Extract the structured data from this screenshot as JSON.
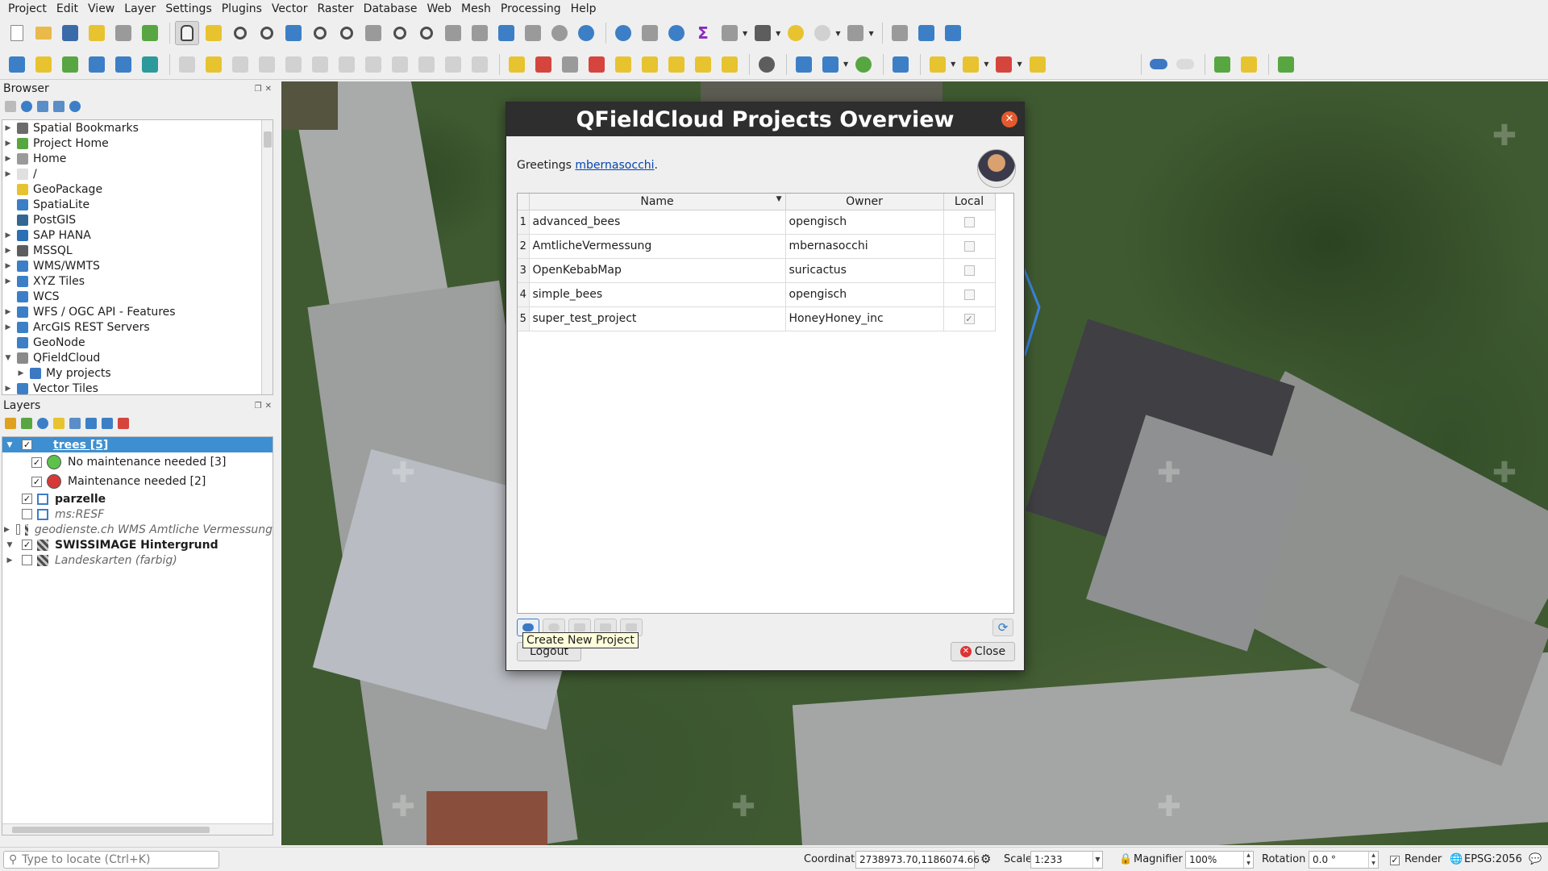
{
  "menu": [
    "Project",
    "Edit",
    "View",
    "Layer",
    "Settings",
    "Plugins",
    "Vector",
    "Raster",
    "Database",
    "Web",
    "Mesh",
    "Processing",
    "Help"
  ],
  "browser": {
    "title": "Browser",
    "items": [
      {
        "label": "Spatial Bookmarks",
        "icon": "bookmark-icon",
        "color": "#6b6b6b",
        "expandable": true
      },
      {
        "label": "Project Home",
        "icon": "project-home-icon",
        "color": "#58a642",
        "expandable": true
      },
      {
        "label": "Home",
        "icon": "home-icon",
        "color": "#9a9a9a",
        "expandable": true
      },
      {
        "label": "/",
        "icon": "folder-icon",
        "color": "#e0e0e0",
        "expandable": true
      },
      {
        "label": "GeoPackage",
        "icon": "geopackage-icon",
        "color": "#e8c330",
        "expandable": false
      },
      {
        "label": "SpatiaLite",
        "icon": "spatialite-icon",
        "color": "#3c7fc6",
        "expandable": false
      },
      {
        "label": "PostGIS",
        "icon": "postgis-icon",
        "color": "#336791",
        "expandable": false
      },
      {
        "label": "SAP HANA",
        "icon": "sap-hana-icon",
        "color": "#2c6fb4",
        "expandable": true
      },
      {
        "label": "MSSQL",
        "icon": "mssql-icon",
        "color": "#5d5d5d",
        "expandable": true
      },
      {
        "label": "WMS/WMTS",
        "icon": "wms-icon",
        "color": "#3c7fc6",
        "expandable": true
      },
      {
        "label": "XYZ Tiles",
        "icon": "xyz-tiles-icon",
        "color": "#3c7fc6",
        "expandable": true
      },
      {
        "label": "WCS",
        "icon": "wcs-icon",
        "color": "#3c7fc6",
        "expandable": false
      },
      {
        "label": "WFS / OGC API - Features",
        "icon": "wfs-icon",
        "color": "#3c7fc6",
        "expandable": true
      },
      {
        "label": "ArcGIS REST Servers",
        "icon": "arcgis-icon",
        "color": "#3c7fc6",
        "expandable": true
      },
      {
        "label": "GeoNode",
        "icon": "geonode-icon",
        "color": "#3c7fc6",
        "expandable": false
      },
      {
        "label": "QFieldCloud",
        "icon": "qfieldcloud-icon",
        "color": "#8a8a8a",
        "expandable": true,
        "expanded": true
      },
      {
        "label": "My projects",
        "icon": "cloud-icon",
        "color": "#3d78c3",
        "expandable": true,
        "indent": true
      },
      {
        "label": "Vector Tiles",
        "icon": "vector-tiles-icon",
        "color": "#3c7fc6",
        "expandable": true
      }
    ]
  },
  "layers": {
    "title": "Layers",
    "items": [
      {
        "label": "trees [5]",
        "bold": true,
        "checked": true,
        "selected": true,
        "symbol": "point",
        "indent": 0,
        "expand": "down"
      },
      {
        "label": "No maintenance needed [3]",
        "checked": true,
        "symbol": "dot",
        "color": "#5bc24a",
        "indent": 1
      },
      {
        "label": "Maintenance needed [2]",
        "checked": true,
        "symbol": "dot",
        "color": "#d63a36",
        "indent": 1
      },
      {
        "label": "parzelle",
        "bold": true,
        "checked": true,
        "symbol": "poly",
        "indent": 0
      },
      {
        "label": "ms:RESF",
        "italic": true,
        "checked": false,
        "symbol": "poly",
        "indent": 0
      },
      {
        "label": "geodienste.ch WMS Amtliche Vermessung",
        "italic": true,
        "checked": false,
        "symbol": "raster",
        "indent": 0,
        "expand": "right"
      },
      {
        "label": "SWISSIMAGE Hintergrund",
        "bold": true,
        "checked": true,
        "symbol": "raster",
        "indent": 0,
        "expand": "down"
      },
      {
        "label": "Landeskarten (farbig)",
        "italic": true,
        "checked": false,
        "symbol": "raster",
        "indent": 0,
        "expand": "right"
      }
    ]
  },
  "dialog": {
    "title": "QFieldCloud Projects Overview",
    "greeting_prefix": "Greetings ",
    "username": "mbernasocchi",
    "greeting_suffix": ".",
    "columns": [
      "Name",
      "Owner",
      "Local"
    ],
    "projects": [
      {
        "num": "1",
        "name": "advanced_bees",
        "owner": "opengisch",
        "local": false
      },
      {
        "num": "2",
        "name": "AmtlicheVermessung",
        "owner": "mbernasocchi",
        "local": false
      },
      {
        "num": "3",
        "name": "OpenKebabMap",
        "owner": "suricactus",
        "local": false
      },
      {
        "num": "4",
        "name": "simple_bees",
        "owner": "opengisch",
        "local": false
      },
      {
        "num": "5",
        "name": "super_test_project",
        "owner": "HoneyHoney_inc",
        "local": true
      }
    ],
    "tooltip": "Create New Project",
    "logout_label": "Logout",
    "close_label": "Close"
  },
  "statusbar": {
    "locator_placeholder": "Type to locate (Ctrl+K)",
    "coordinate_label": "Coordinate",
    "coordinate_value": "2738973.70,1186074.66",
    "scale_label": "Scale",
    "scale_value": "1:233",
    "magnifier_label": "Magnifier",
    "magnifier_value": "100%",
    "rotation_label": "Rotation",
    "rotation_value": "0.0 °",
    "render_label": "Render",
    "render_checked": true,
    "crs": "EPSG:2056"
  }
}
